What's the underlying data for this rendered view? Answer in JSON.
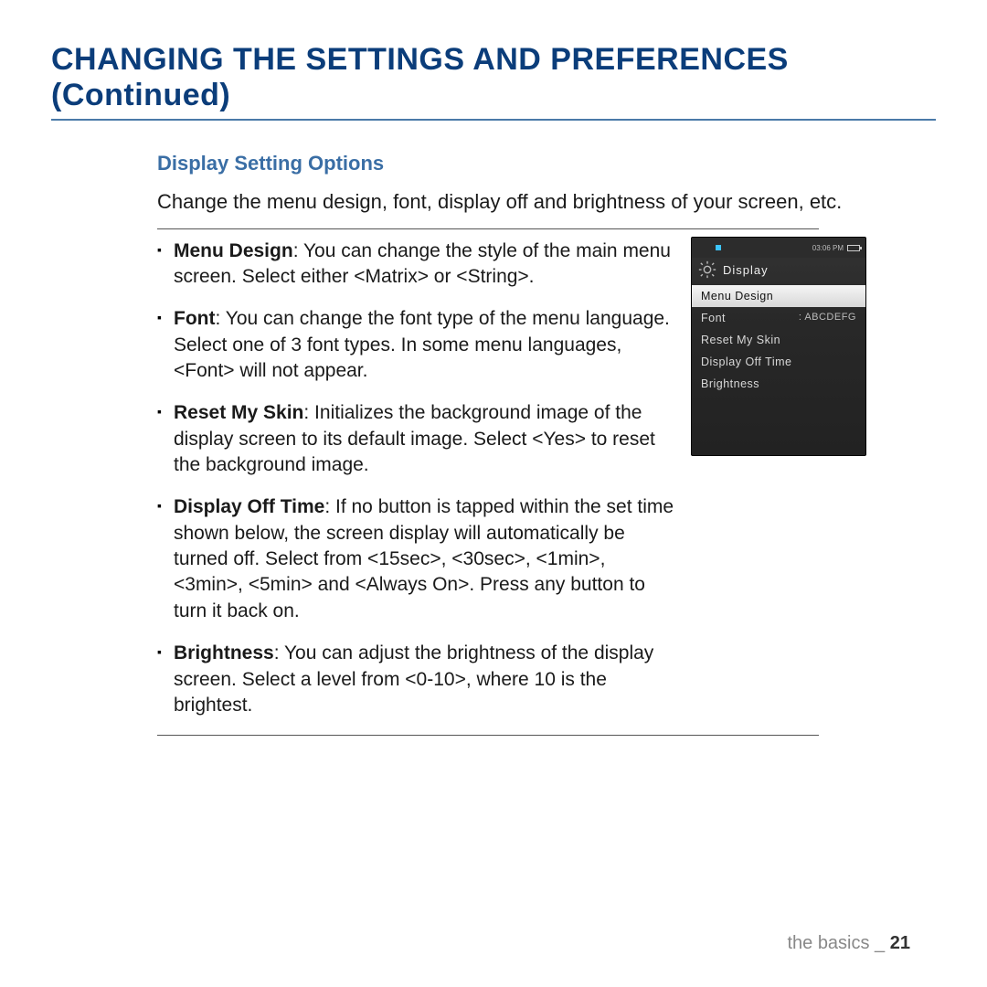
{
  "page_title": "CHANGING THE SETTINGS AND PREFERENCES (Continued)",
  "subheading": "Display Setting Options",
  "intro": "Change the menu design, font, display off and brightness of your screen, etc.",
  "bullets": [
    {
      "term": "Menu Design",
      "desc": ": You can change the style of the main menu screen. Select either <Matrix> or <String>."
    },
    {
      "term": "Font",
      "desc": ": You can change the font type of the menu language. Select one of 3 font types. In some menu languages, <Font> will not appear."
    },
    {
      "term": "Reset My Skin",
      "desc": ": Initializes the background image of the display screen to its default image. Select <Yes> to reset the background image."
    },
    {
      "term": "Display Off Time",
      "desc": ": If no button is tapped within the set time shown below, the screen display will automatically be turned off. Select from <15sec>, <30sec>, <1min>, <3min>, <5min> and <Always On>. Press any button to turn it back on."
    },
    {
      "term": "Brightness",
      "desc": ": You can adjust the brightness of the display screen. Select a level from <0-10>, where 10 is the brightest."
    }
  ],
  "device": {
    "status_time": "03:06 PM",
    "title": "Display",
    "items": [
      {
        "label": "Menu Design",
        "value": "",
        "selected": true
      },
      {
        "label": "Font",
        "value": ": ABCDEFG",
        "selected": false
      },
      {
        "label": "Reset My Skin",
        "value": "",
        "selected": false
      },
      {
        "label": "Display Off Time",
        "value": "",
        "selected": false
      },
      {
        "label": "Brightness",
        "value": "",
        "selected": false
      }
    ]
  },
  "footer": {
    "section": "the basics _ ",
    "page": "21"
  }
}
